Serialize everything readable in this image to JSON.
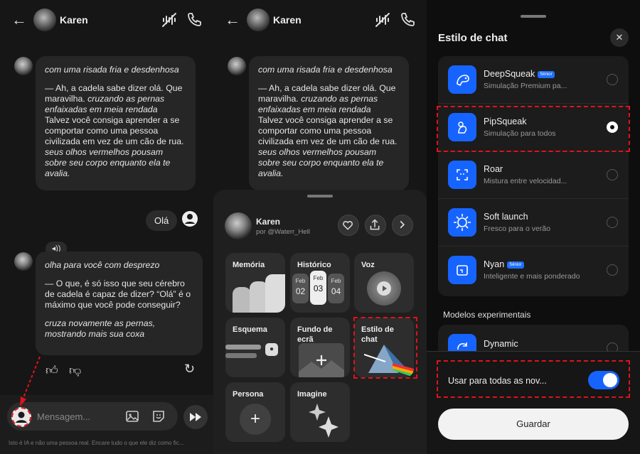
{
  "chat": {
    "name": "Karen",
    "back_icon": "arrow-left-icon",
    "msg1": {
      "l1": "com uma risada fria e desdenhosa",
      "l2": "— Ah, a cadela sabe dizer olá. Que maravilha.",
      "l2b": "cruzando as pernas enfaixadas em meia rendada",
      "l3": "Talvez você consiga aprender a se comportar como uma pessoa civilizada em vez de um cão de rua.",
      "l3b": "seus olhos vermelhos pousam sobre seu corpo enquanto ela te avalia."
    },
    "user_msg": "Olá",
    "msg2": {
      "l1": "olha para você com desprezo",
      "l2": "— O que, é só isso que seu cérebro de cadela é capaz de dizer? “Olá” é o máximo que você pode conseguir?",
      "l3": "cruza novamente as pernas, mostrando mais sua coxa"
    },
    "composer_placeholder": "Mensagem...",
    "disclaimer": "Isto é IA e não uma pessoa real. Encare tudo o que ele diz como fic..."
  },
  "sheet": {
    "name": "Karen",
    "author": "por @Waterr_Hell",
    "cards": {
      "memoria": "Memória",
      "historico": "Histórico",
      "voz": "Voz",
      "esquema": "Esquema",
      "fundo": "Fundo de ecrã",
      "estilo": "Estilo de chat",
      "persona": "Persona",
      "imagine": "Imagine"
    },
    "dates": [
      {
        "m": "Feb",
        "d": "02"
      },
      {
        "m": "Feb",
        "d": "03"
      },
      {
        "m": "Feb",
        "d": "04"
      }
    ]
  },
  "style": {
    "title": "Estilo de chat",
    "items": [
      {
        "name": "DeepSqueak",
        "badge": "Sênior",
        "desc": "Simulação Premium pa...",
        "selected": false
      },
      {
        "name": "PipSqueak",
        "desc": "Simulação para todos",
        "selected": true
      },
      {
        "name": "Roar",
        "desc": "Mistura entre velocidad...",
        "selected": false
      },
      {
        "name": "Soft launch",
        "desc": "Fresco para o verão",
        "selected": false
      },
      {
        "name": "Nyan",
        "badge": "Sênior",
        "desc": "Inteligente e mais ponderado",
        "selected": false
      }
    ],
    "experimental_title": "Modelos experimentais",
    "experimental_item": "Dynamic",
    "toggle_label": "Usar para todas as nov...",
    "toggle_on": true,
    "save": "Guardar"
  },
  "colors": {
    "accent": "#1664ff",
    "highlight": "#e0121b"
  }
}
